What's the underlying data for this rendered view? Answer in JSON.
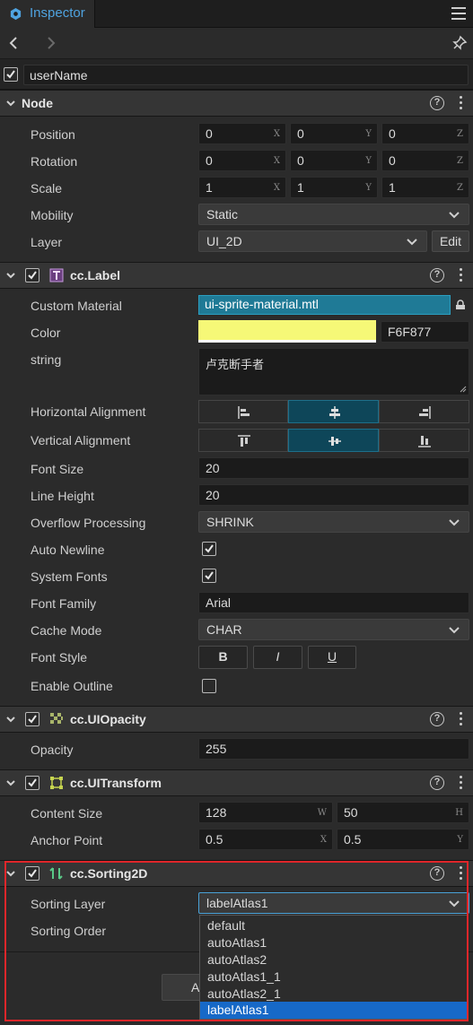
{
  "tab": {
    "label": "Inspector"
  },
  "node_name": "userName",
  "sections": {
    "node": {
      "title": "Node"
    },
    "label": {
      "title": "cc.Label"
    },
    "opacity": {
      "title": "cc.UIOpacity"
    },
    "transform": {
      "title": "cc.UITransform"
    },
    "sorting": {
      "title": "cc.Sorting2D"
    }
  },
  "node": {
    "position": {
      "label": "Position",
      "x": "0",
      "y": "0",
      "z": "0"
    },
    "rotation": {
      "label": "Rotation",
      "x": "0",
      "y": "0",
      "z": "0"
    },
    "scale": {
      "label": "Scale",
      "x": "1",
      "y": "1",
      "z": "1"
    },
    "mobility": {
      "label": "Mobility",
      "value": "Static"
    },
    "layer": {
      "label": "Layer",
      "value": "UI_2D",
      "edit": "Edit"
    }
  },
  "axes": {
    "x": "X",
    "y": "Y",
    "z": "Z",
    "w": "W",
    "h": "H"
  },
  "label": {
    "custom_material": {
      "label": "Custom Material",
      "value": "ui-sprite-material.mtl"
    },
    "color": {
      "label": "Color",
      "hex": "F6F877",
      "swatch": "#f6f877"
    },
    "string": {
      "label": "string",
      "value": "卢克断手者"
    },
    "h_align": {
      "label": "Horizontal Alignment"
    },
    "v_align": {
      "label": "Vertical Alignment"
    },
    "font_size": {
      "label": "Font Size",
      "value": "20"
    },
    "line_height": {
      "label": "Line Height",
      "value": "20"
    },
    "overflow": {
      "label": "Overflow Processing",
      "value": "SHRINK"
    },
    "auto_newline": {
      "label": "Auto Newline"
    },
    "system_fonts": {
      "label": "System Fonts"
    },
    "font_family": {
      "label": "Font Family",
      "value": "Arial"
    },
    "cache_mode": {
      "label": "Cache Mode",
      "value": "CHAR"
    },
    "font_style": {
      "label": "Font Style",
      "bold": "B",
      "italic": "I",
      "underline": "U"
    },
    "enable_outline": {
      "label": "Enable Outline"
    }
  },
  "opacity": {
    "label": "Opacity",
    "value": "255"
  },
  "transform": {
    "content_size": {
      "label": "Content Size",
      "w": "128",
      "h": "50"
    },
    "anchor_point": {
      "label": "Anchor Point",
      "x": "0.5",
      "y": "0.5"
    }
  },
  "sorting": {
    "layer": {
      "label": "Sorting Layer",
      "value": "labelAtlas1"
    },
    "order": {
      "label": "Sorting Order"
    },
    "options": [
      "default",
      "autoAtlas1",
      "autoAtlas2",
      "autoAtlas1_1",
      "autoAtlas2_1",
      "labelAtlas1"
    ],
    "button_partial": "A"
  },
  "colors": {
    "accent": "#4fa3e0",
    "highlight": "#e0262a",
    "selected": "#1769c7"
  }
}
